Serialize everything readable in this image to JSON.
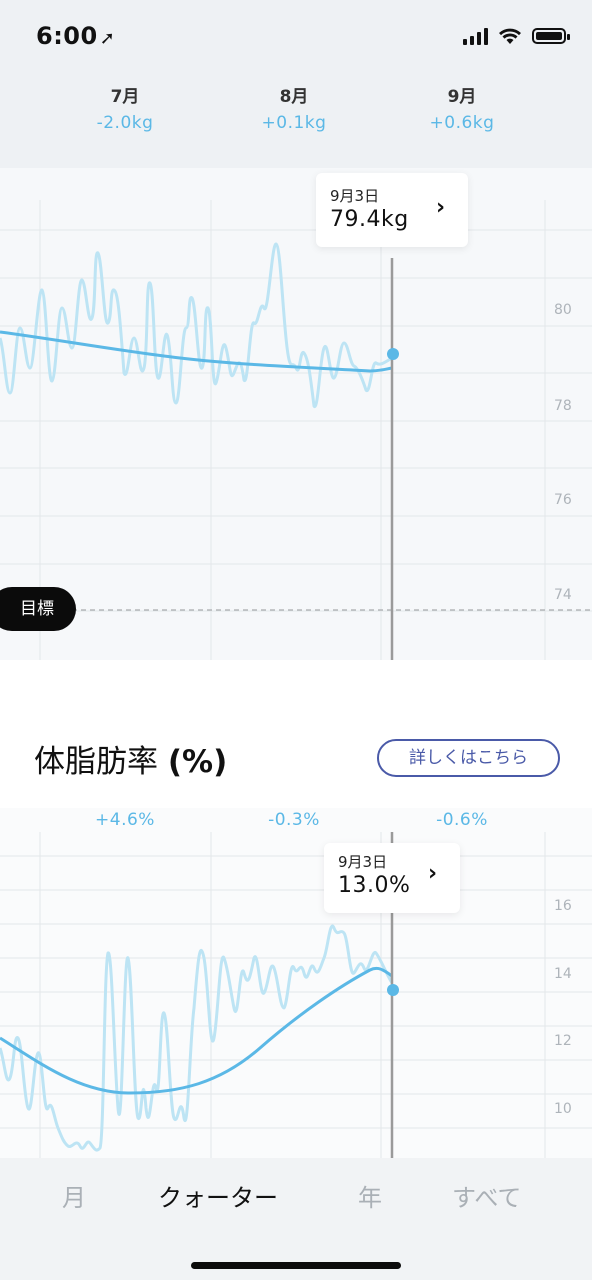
{
  "status_bar": {
    "time": "6:00",
    "location_icon": "location-arrow-icon",
    "icons": [
      "signal-icon",
      "wifi-icon",
      "battery-icon"
    ]
  },
  "weight_months": [
    {
      "month": "7月",
      "delta": "-2.0kg"
    },
    {
      "month": "8月",
      "delta": "+0.1kg"
    },
    {
      "month": "9月",
      "delta": "+0.6kg"
    }
  ],
  "weight_chart": {
    "tooltip": {
      "date": "9月3日",
      "value": "79.4kg"
    },
    "y_ticks": [
      "80",
      "78",
      "76",
      "74"
    ],
    "goal_label": "目標",
    "colors": {
      "raw": "#bde4f4",
      "trend": "#5bb8e6",
      "cursor": "#9a9a9a"
    }
  },
  "body_fat": {
    "title": "体脂肪率",
    "unit": "(%)",
    "detail_button": "詳しくはこちら",
    "deltas": [
      "+4.6%",
      "-0.3%",
      "-0.6%"
    ],
    "tooltip": {
      "date": "9月3日",
      "value": "13.0%"
    },
    "y_ticks": [
      "16",
      "14",
      "12",
      "10"
    ]
  },
  "tabs": [
    "月",
    "クォーター",
    "年",
    "すべて"
  ],
  "active_tab": "クォーター"
}
